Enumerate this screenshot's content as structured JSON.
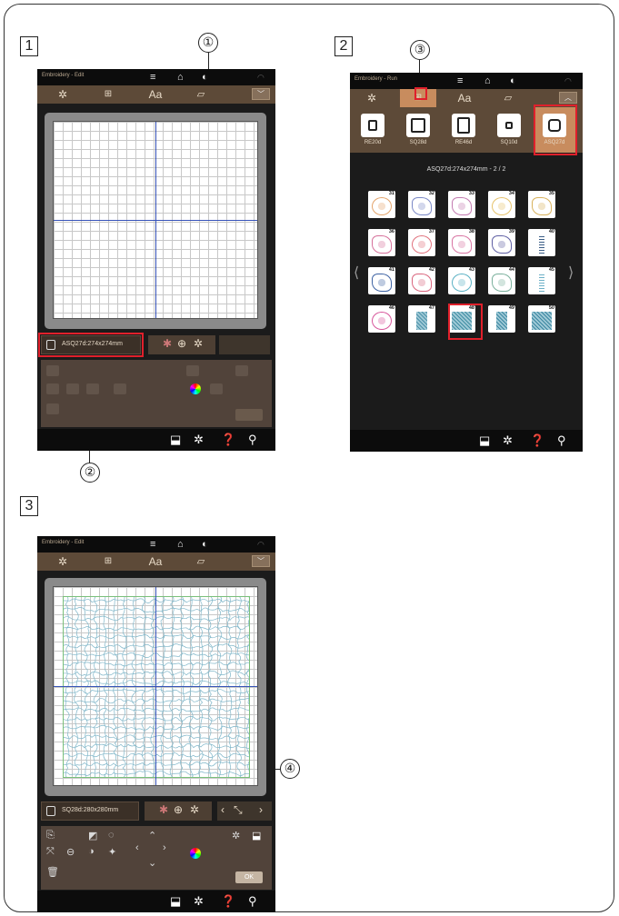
{
  "steps": [
    "1",
    "2",
    "3"
  ],
  "callouts": [
    "①",
    "②",
    "③",
    "④"
  ],
  "screen1": {
    "title": "Embroidery - Edit",
    "tabs": [
      "✲",
      "⊞",
      "Aa",
      "▱"
    ],
    "hoop_label": "ASQ27d:274x274mm"
  },
  "screen2": {
    "title": "Embroidery - Run",
    "tabs": [
      "✲",
      "⊞",
      "Aa",
      "▱"
    ],
    "hoops": [
      {
        "name": "RE20d",
        "selected": false
      },
      {
        "name": "SQ28d",
        "selected": false
      },
      {
        "name": "RE46d",
        "selected": false
      },
      {
        "name": "SQ10d",
        "selected": false
      },
      {
        "name": "ASQ27d",
        "selected": true
      }
    ],
    "page_caption": "ASQ27d:274x274mm - 2 / 2",
    "pattern_numbers": [
      "31",
      "32",
      "33",
      "34",
      "35",
      "36",
      "37",
      "38",
      "39",
      "40",
      "41",
      "42",
      "43",
      "44",
      "45",
      "46",
      "47",
      "48",
      "49",
      "50"
    ],
    "selected_pattern": "48"
  },
  "screen3": {
    "title": "Embroidery - Edit",
    "tabs": [
      "✲",
      "⊞",
      "Aa",
      "▱"
    ],
    "hoop_label": "SQ28d:280x280mm",
    "ok_label": "OK"
  },
  "colors": {
    "accent": "#c88c5e",
    "highlight": "#e0202b",
    "panel": "#5d4a38",
    "axis": "#3552b8"
  }
}
